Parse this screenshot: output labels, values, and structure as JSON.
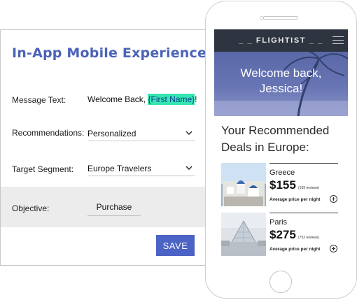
{
  "panel": {
    "title": "In-App Mobile Experience",
    "message": {
      "label": "Message Text:",
      "prefix": "Welcome Back, ",
      "token": "{First Name}",
      "suffix": "!"
    },
    "recommendations": {
      "label": "Recommendations:",
      "value": "Personalized"
    },
    "segment": {
      "label": "Target Segment:",
      "value": "Europe Travelers"
    },
    "objective": {
      "label": "Objective:",
      "value": "Purchase"
    },
    "save_label": "SAVE",
    "colors": {
      "accent": "#4b63b8",
      "button": "#4b63c4",
      "token_highlight": "#36e6b2"
    }
  },
  "phone": {
    "brand": "_ _ FLIGHTIST _ _",
    "hero_line1": "Welcome back,",
    "hero_line2": "Jessica!",
    "deals_heading_line1": "Your Recommended",
    "deals_heading_line2": "Deals in Europe:",
    "deals": [
      {
        "city": "Greece",
        "price": "$155",
        "reviews": "(169 reviews)",
        "avg_label": "Average price per night"
      },
      {
        "city": "Paris",
        "price": "$275",
        "reviews": "(752 reviews)",
        "avg_label": "Average price per night"
      }
    ],
    "icons": {
      "menu": "hamburger-icon",
      "add": "plus-circle-icon",
      "select": "chevron-down-icon"
    }
  }
}
